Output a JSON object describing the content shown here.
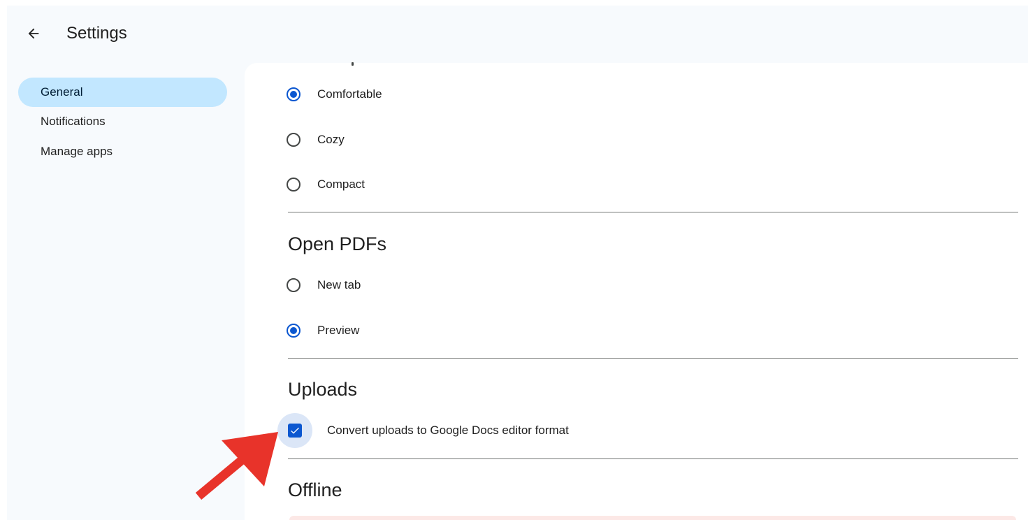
{
  "header": {
    "back_icon": "arrow-back-icon",
    "title": "Settings"
  },
  "sidebar": {
    "items": [
      {
        "label": "General",
        "active": true
      },
      {
        "label": "Notifications",
        "active": false
      },
      {
        "label": "Manage apps",
        "active": false
      }
    ]
  },
  "density": {
    "options": [
      {
        "label": "Comfortable",
        "selected": true
      },
      {
        "label": "Cozy",
        "selected": false
      },
      {
        "label": "Compact",
        "selected": false
      }
    ]
  },
  "open_pdfs": {
    "heading": "Open PDFs",
    "options": [
      {
        "label": "New tab",
        "selected": false
      },
      {
        "label": "Preview",
        "selected": true
      }
    ]
  },
  "uploads": {
    "heading": "Uploads",
    "convert_label": "Convert uploads to Google Docs editor format",
    "convert_checked": true
  },
  "offline": {
    "heading": "Offline"
  },
  "annotation": {
    "arrow_icon": "red-arrow-icon",
    "arrow_color": "#e8332a"
  },
  "colors": {
    "accent": "#0b57d0",
    "active_nav": "#c2e7ff",
    "app_background": "#f7fafd"
  }
}
